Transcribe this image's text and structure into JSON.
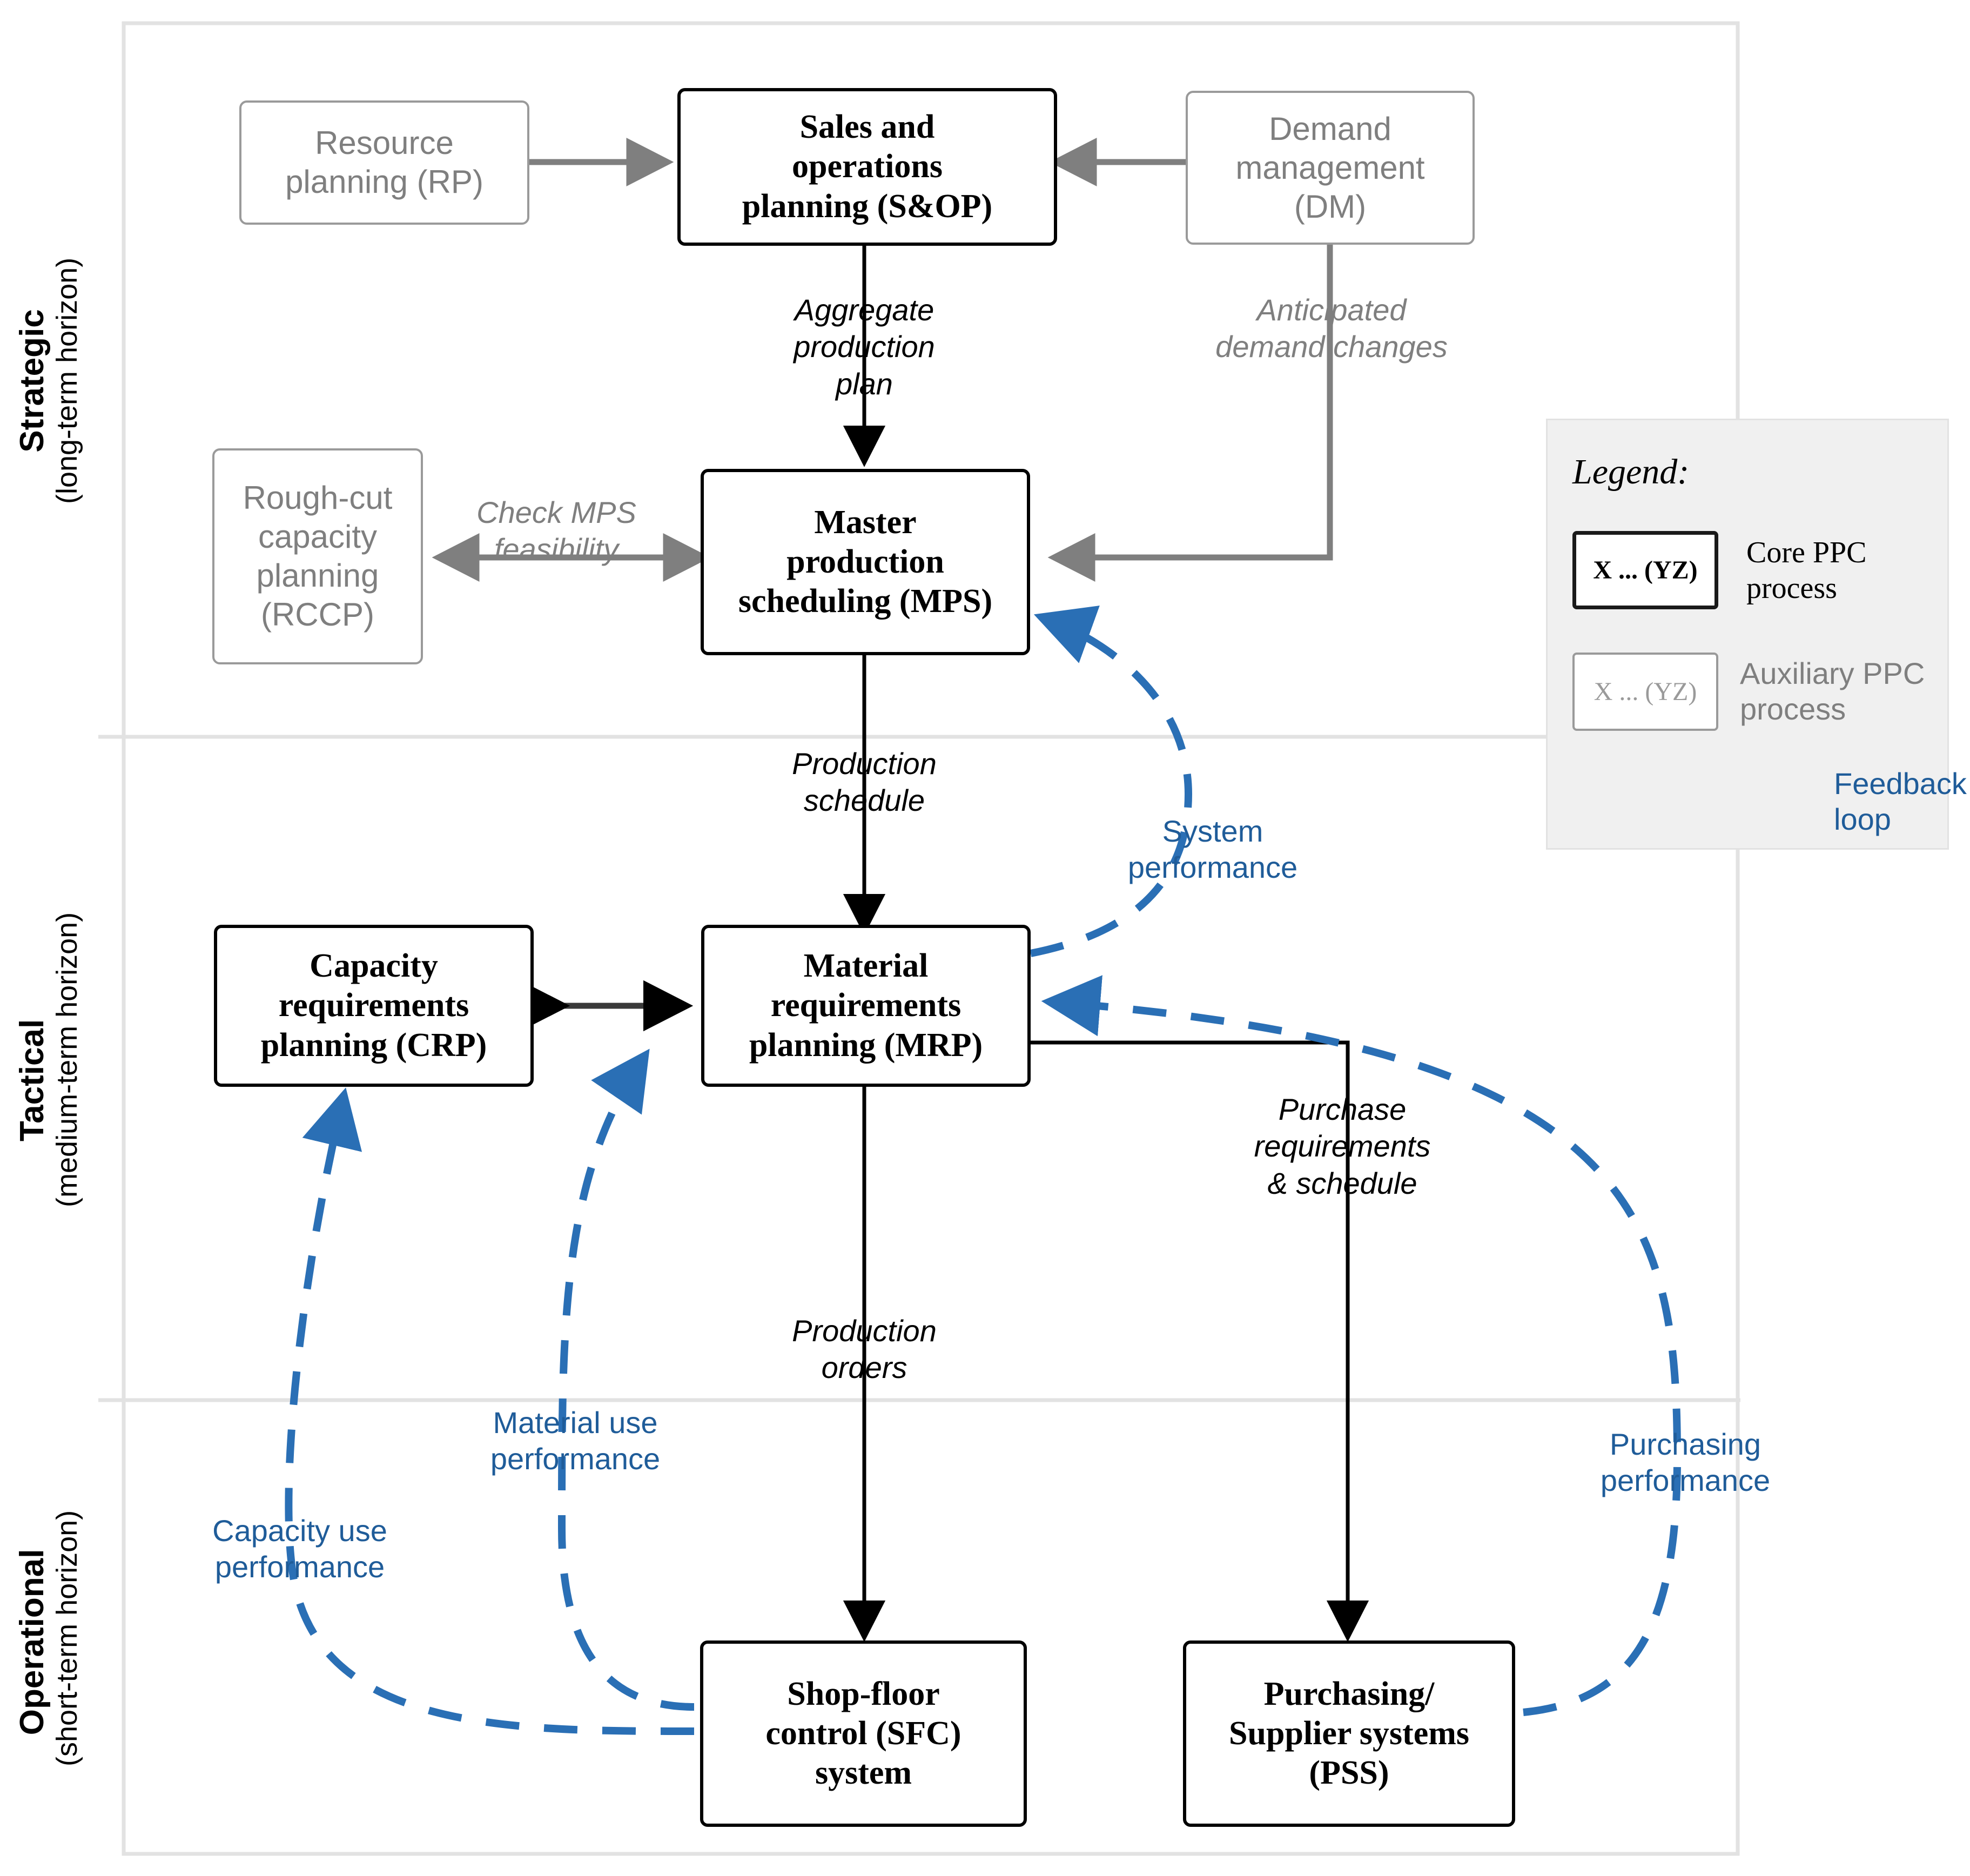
{
  "horizons": [
    {
      "title": "Strategic",
      "subtitle": "(long-term horizon)"
    },
    {
      "title": "Tactical",
      "subtitle": "(medium-term horizon)"
    },
    {
      "title": "Operational",
      "subtitle": "(short-term horizon)"
    }
  ],
  "nodes": {
    "rp": {
      "kind": "auxiliary",
      "lines": [
        "Resource",
        "planning (RP)"
      ]
    },
    "sop": {
      "kind": "core",
      "lines": [
        "Sales and",
        "operations",
        "planning (S&OP)"
      ]
    },
    "dm": {
      "kind": "auxiliary",
      "lines": [
        "Demand",
        "management",
        "(DM)"
      ]
    },
    "rccp": {
      "kind": "auxiliary",
      "lines": [
        "Rough-cut",
        "capacity",
        "planning",
        "(RCCP)"
      ]
    },
    "mps": {
      "kind": "core",
      "lines": [
        "Master",
        "production",
        "scheduling (MPS)"
      ]
    },
    "crp": {
      "kind": "core",
      "lines": [
        "Capacity",
        "requirements",
        "planning (CRP)"
      ]
    },
    "mrp": {
      "kind": "core",
      "lines": [
        "Material",
        "requirements",
        "planning (MRP)"
      ]
    },
    "sfc": {
      "kind": "core",
      "lines": [
        "Shop-floor",
        "control (SFC)",
        "system"
      ]
    },
    "pss": {
      "kind": "core",
      "lines": [
        "Purchasing/",
        "Supplier systems",
        "(PSS)"
      ]
    }
  },
  "flow_labels": {
    "aggregate_production_plan": [
      "Aggregate",
      "production",
      "plan"
    ],
    "anticipated_demand_changes": [
      "Anticipated",
      "demand changes"
    ],
    "check_mps_feasibility": [
      "Check MPS",
      "feasibility"
    ],
    "production_schedule": [
      "Production",
      "schedule"
    ],
    "production_orders": [
      "Production",
      "orders"
    ],
    "purchase_requirements_schedule": [
      "Purchase",
      "requirements",
      "& schedule"
    ]
  },
  "feedback_labels": {
    "system_performance": [
      "System",
      "performance"
    ],
    "material_use_performance": [
      "Material use",
      "performance"
    ],
    "capacity_use_performance": [
      "Capacity use",
      "performance"
    ],
    "purchasing_performance": [
      "Purchasing",
      "performance"
    ]
  },
  "legend": {
    "title": "Legend:",
    "core_sample": "X ... (YZ)",
    "core_label": "Core PPC process",
    "aux_sample": "X ... (YZ)",
    "aux_label": "Auxiliary PPC process",
    "feedback_label": "Feedback loop"
  },
  "colors": {
    "core_border": "#000000",
    "aux_border": "#9a9a9a",
    "aux_text": "#7f7f7f",
    "feedback_blue": "#2a6fb5",
    "feedback_text_blue": "#1f5c99",
    "frame_grey": "#e2e2e2",
    "arrow_grey": "#7f7f7f",
    "arrow_black": "#000000",
    "legend_bg": "#f0f0f0"
  }
}
